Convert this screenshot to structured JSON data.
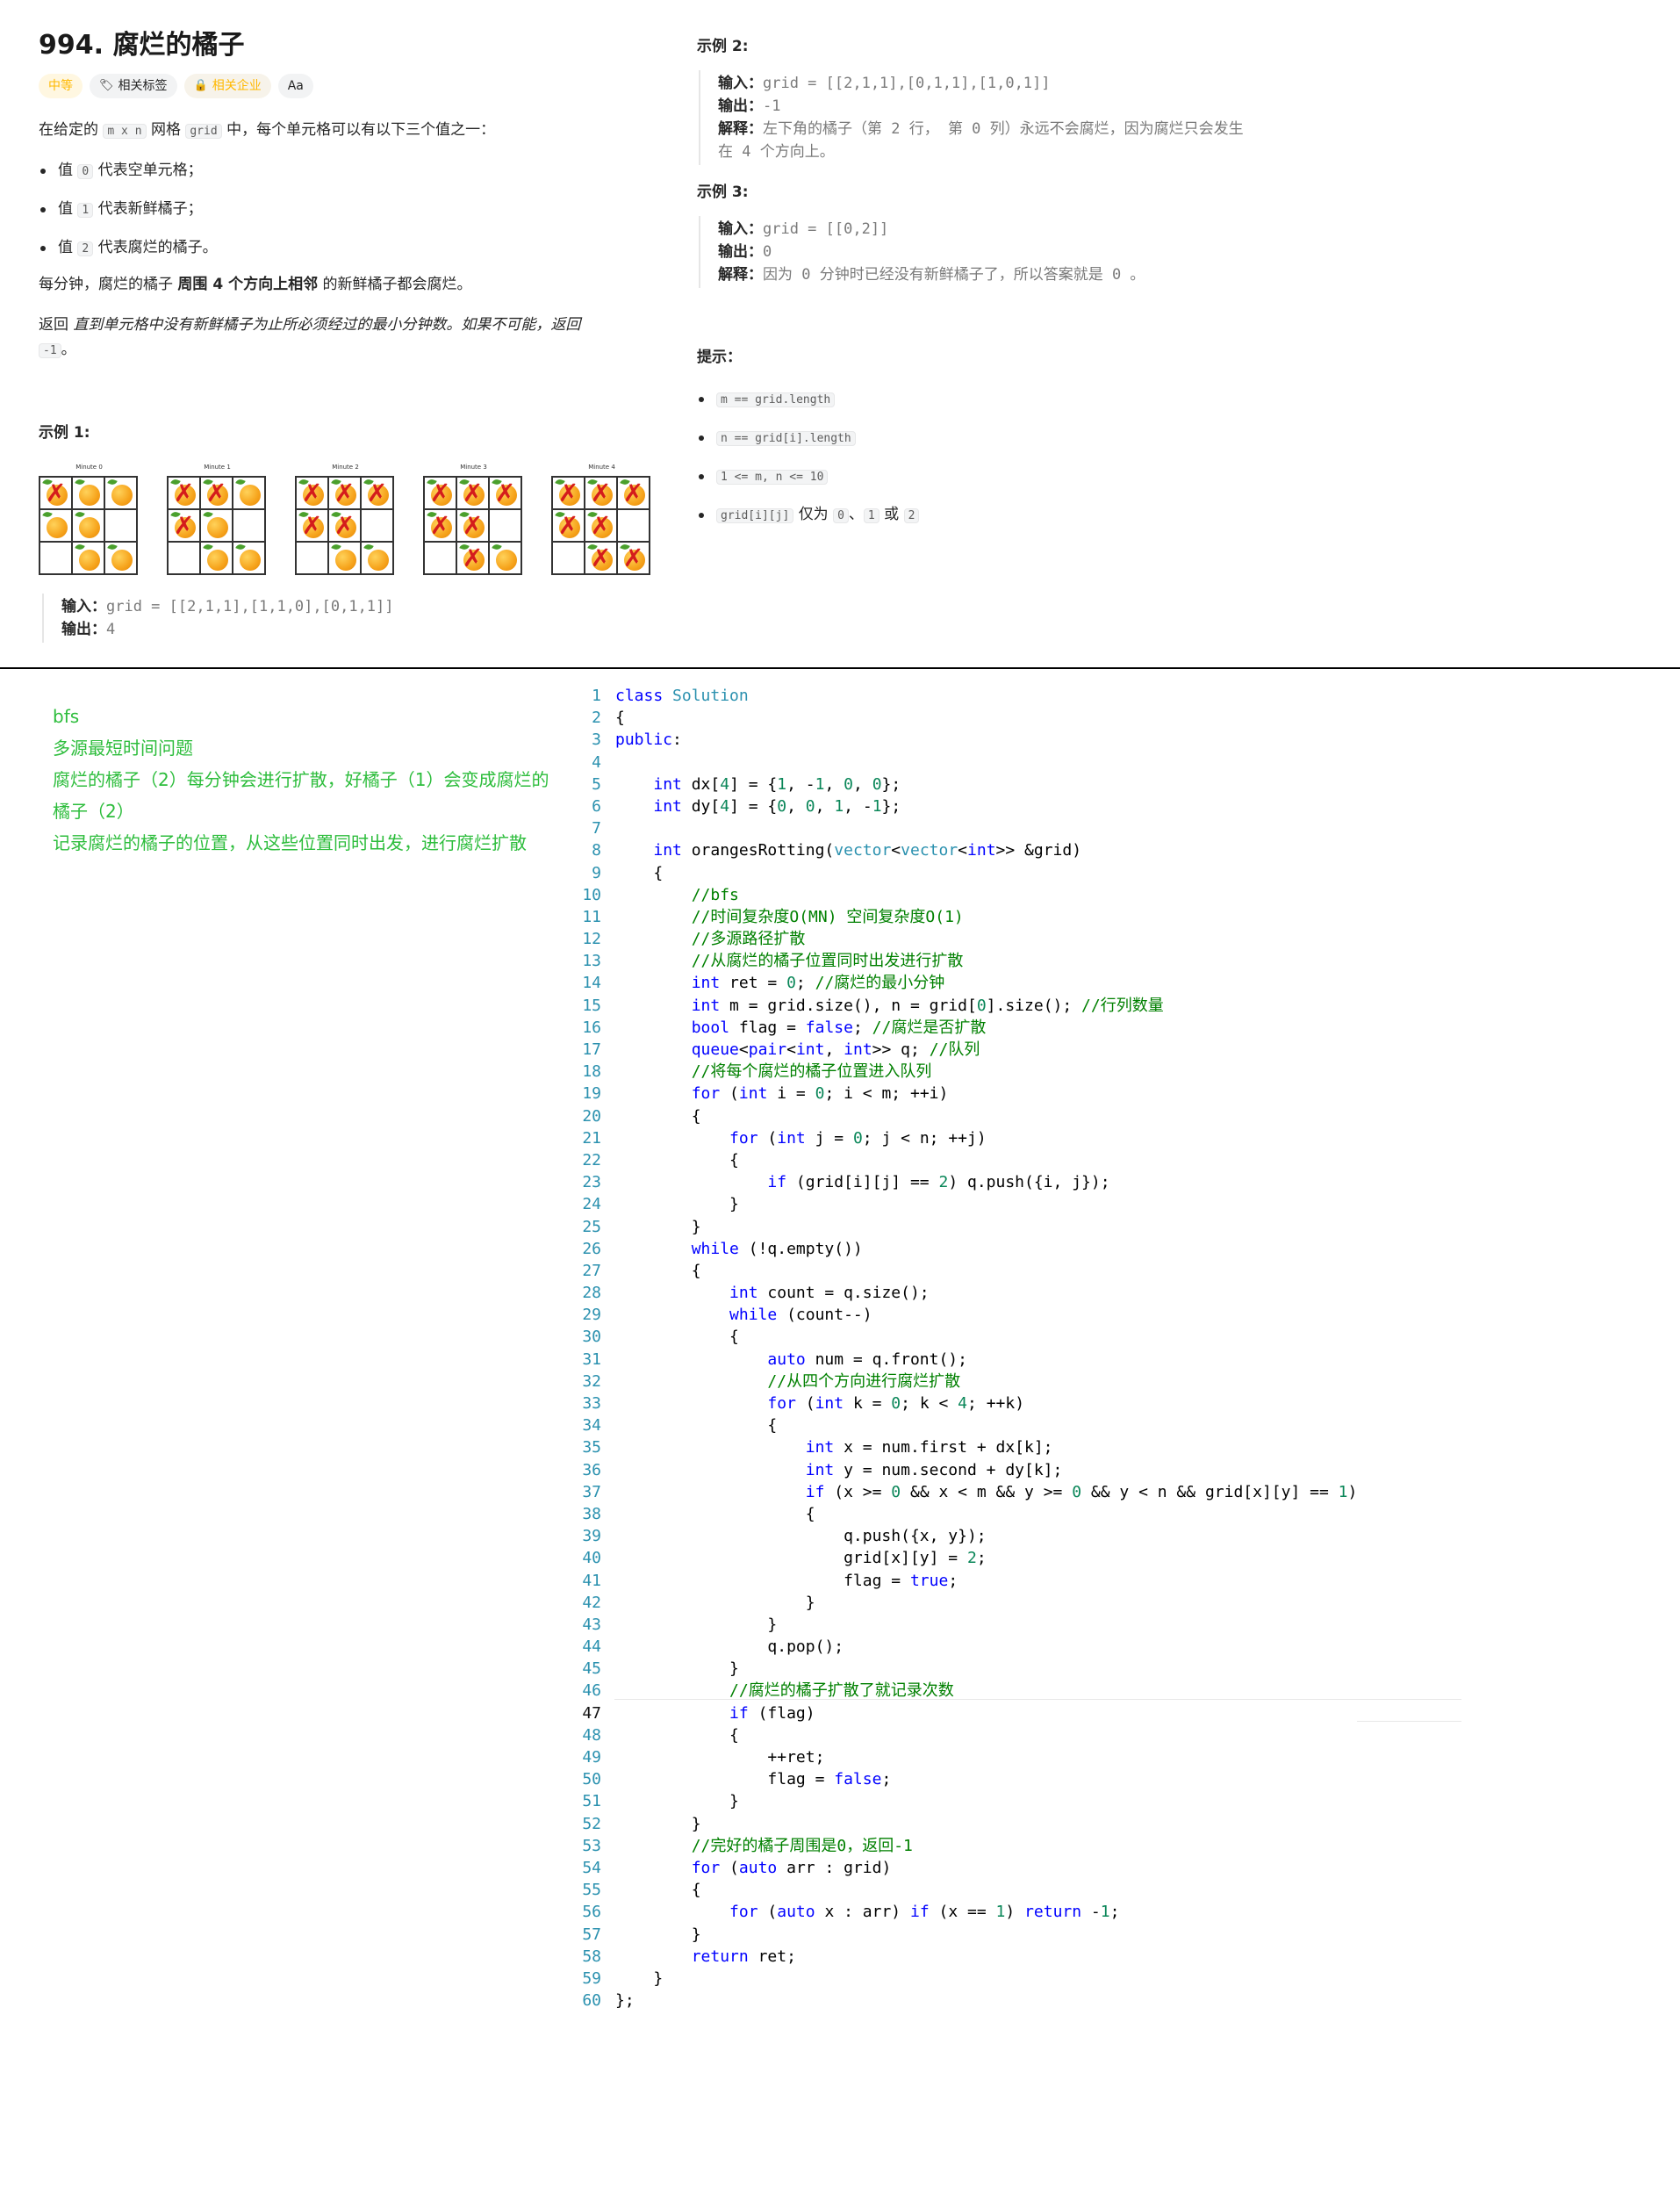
{
  "problem": {
    "title": "994. 腐烂的橘子",
    "tags": {
      "difficulty": "中等",
      "related_tags": "相关标签",
      "related_companies": "相关企业",
      "font_toggle": "Aa"
    },
    "intro_pre": "在给定的",
    "intro_code_m": "m x n",
    "intro_mid": "网格",
    "intro_code_grid": "grid",
    "intro_post": "中，每个单元格可以有以下三个值之一：",
    "items": [
      {
        "pre": "值",
        "code": "0",
        "post": "代表空单元格；"
      },
      {
        "pre": "值",
        "code": "1",
        "post": "代表新鲜橘子；"
      },
      {
        "pre": "值",
        "code": "2",
        "post": "代表腐烂的橘子。"
      }
    ],
    "rule_pre": "每分钟，腐烂的橘子",
    "rule_bold": "周围 4 个方向上相邻",
    "rule_post": "的新鲜橘子都会腐烂。",
    "return_pre": "返回",
    "return_italic": "直到单元格中没有新鲜橘子为止所必须经过的最小分钟数。如果不可能，返回",
    "return_code": "-1",
    "return_post": "。",
    "example1": {
      "heading": "示例 1:",
      "minutes": [
        "Minute 0",
        "Minute 1",
        "Minute 2",
        "Minute 3",
        "Minute 4"
      ],
      "input_label": "输入：",
      "input": "grid = [[2,1,1],[1,1,0],[0,1,1]]",
      "output_label": "输出：",
      "output": "4"
    },
    "example2": {
      "heading": "示例 2:",
      "input_label": "输入：",
      "input": "grid = [[2,1,1],[0,1,1],[1,0,1]]",
      "output_label": "输出：",
      "output": "-1",
      "explain_label": "解释：",
      "explain_line1": "左下角的橘子（第 2 行， 第 0 列）永远不会腐烂，因为腐烂只会发生",
      "explain_line2": "在 4 个方向上。"
    },
    "example3": {
      "heading": "示例 3:",
      "input_label": "输入：",
      "input": "grid = [[0,2]]",
      "output_label": "输出：",
      "output": "0",
      "explain_label": "解释：",
      "explain": "因为 0 分钟时已经没有新鲜橘子了，所以答案就是 0 。"
    },
    "hints": {
      "heading": "提示：",
      "items": [
        "m == grid.length",
        "n == grid[i].length",
        "1 <= m, n <= 10"
      ],
      "last_code": "grid[i][j]",
      "last_mid": "仅为",
      "last_v0": "0",
      "last_sep": "、",
      "last_v1": "1",
      "last_or": "或",
      "last_v2": "2"
    }
  },
  "notes": [
    "bfs",
    "多源最短时间问题",
    "腐烂的橘子（2）每分钟会进行扩散，好橘子（1）会变成腐烂的",
    "橘子（2）",
    "记录腐烂的橘子的位置，从这些位置同时出发，进行腐烂扩散"
  ],
  "code_lines": [
    "class Solution",
    "{",
    "public:",
    "",
    "    int dx[4] = {1, -1, 0, 0};",
    "    int dy[4] = {0, 0, 1, -1};",
    "",
    "    int orangesRotting(vector<vector<int>> &grid)",
    "    {",
    "        //bfs",
    "        //时间复杂度O(MN) 空间复杂度O(1)",
    "        //多源路径扩散",
    "        //从腐烂的橘子位置同时出发进行扩散",
    "        int ret = 0; //腐烂的最小分钟",
    "        int m = grid.size(), n = grid[0].size(); //行列数量",
    "        bool flag = false; //腐烂是否扩散",
    "        queue<pair<int, int>> q; //队列",
    "        //将每个腐烂的橘子位置进入队列",
    "        for (int i = 0; i < m; ++i)",
    "        {",
    "            for (int j = 0; j < n; ++j)",
    "            {",
    "                if (grid[i][j] == 2) q.push({i, j});",
    "            }",
    "        }",
    "        while (!q.empty())",
    "        {",
    "            int count = q.size();",
    "            while (count--)",
    "            {",
    "                auto num = q.front();",
    "                //从四个方向进行腐烂扩散",
    "                for (int k = 0; k < 4; ++k)",
    "                {",
    "                    int x = num.first + dx[k];",
    "                    int y = num.second + dy[k];",
    "                    if (x >= 0 && x < m && y >= 0 && y < n && grid[x][y] == 1)",
    "                    {",
    "                        q.push({x, y});",
    "                        grid[x][y] = 2;",
    "                        flag = true;",
    "                    }",
    "                }",
    "                q.pop();",
    "            }",
    "            //腐烂的橘子扩散了就记录次数",
    "            if (flag)",
    "            {",
    "                ++ret;",
    "                flag = false;",
    "            }",
    "        }",
    "        //完好的橘子周围是0，返回-1",
    "        for (auto arr : grid)",
    "        {",
    "            for (auto x : arr) if (x == 1) return -1;",
    "        }",
    "        return ret;",
    "    }",
    "};"
  ],
  "current_line": 47,
  "colors": {
    "keyword": "#0000ff",
    "comment": "#008000",
    "number": "#098658",
    "type": "#2b91af",
    "note_green": "#2dbd3c",
    "difficulty": "#ffb800"
  }
}
